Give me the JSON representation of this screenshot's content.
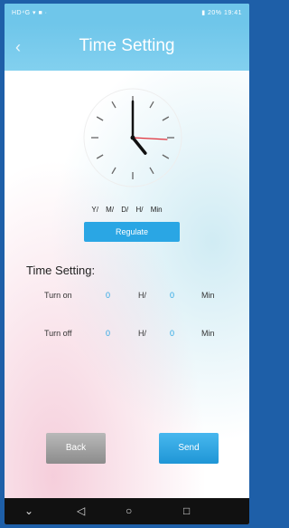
{
  "status_bar": {
    "left_text": "HD⁴G ▾ ■ ·",
    "right_text": "▮ 20% 19:41"
  },
  "header": {
    "title": "Time Setting",
    "back_icon": "chevron-left-icon"
  },
  "clock": {
    "hands": {
      "hour": 4.7,
      "minute": 60,
      "second": 15.5
    }
  },
  "date_labels": "Y/ M/ D/ H/ Min",
  "regulate_button": "Regulate",
  "time_setting": {
    "title": "Time Setting:",
    "turn_on": {
      "label": "Turn on",
      "hour": "0",
      "hour_unit": "H/",
      "minute": "0",
      "minute_unit": "Min"
    },
    "turn_off": {
      "label": "Turn off",
      "hour": "0",
      "hour_unit": "H/",
      "minute": "0",
      "minute_unit": "Min"
    }
  },
  "buttons": {
    "back": "Back",
    "send": "Send"
  },
  "nav_bar": {
    "icons": [
      "chevron-down-icon",
      "back-triangle-icon",
      "home-circle-icon",
      "recents-square-icon"
    ]
  },
  "colors": {
    "header": "#6fc6ea",
    "accent": "#2aa6e4",
    "second_hand": "#e0303a",
    "frame": "#1e5fa8"
  }
}
